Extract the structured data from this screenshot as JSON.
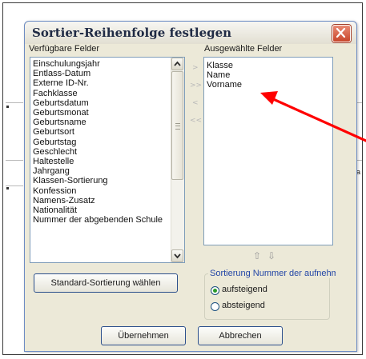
{
  "dialog": {
    "title": "Sortier-Reihenfolge festlegen",
    "available_label": "Verfügbare Felder",
    "selected_label": "Ausgewählte Felder",
    "available_items": [
      "Einschulungsjahr",
      "Entlass-Datum",
      "Externe ID-Nr.",
      "Fachklasse",
      "Geburtsdatum",
      "Geburtsmonat",
      "Geburtsname",
      "Geburtsort",
      "Geburtstag",
      "Geschlecht",
      "Haltestelle",
      "Jahrgang",
      "Klassen-Sortierung",
      "Konfession",
      "Namens-Zusatz",
      "Nationalität",
      "Nummer der abgebenden Schule"
    ],
    "selected_items": [
      "Klasse",
      "Name",
      "Vorname"
    ],
    "move_buttons": [
      ">",
      ">>",
      "<",
      "<<"
    ],
    "order_up": "⇧",
    "order_down": "⇩",
    "standard_button": "Standard-Sortierung wählen",
    "sort_group_label": "Sortierung Nummer der aufnehmenden",
    "ascending_label": "aufsteigend",
    "descending_label": "absteigend",
    "sort_selected": "aufsteigend",
    "apply_button": "Übernehmen",
    "cancel_button": "Abbrechen"
  },
  "background": {
    "partial_text": "a"
  },
  "colors": {
    "annotation_arrow": "#ff0000",
    "close_button": "#c8452a",
    "radio_selected": "#2a9a2a"
  },
  "icons": {
    "close": "close-icon",
    "scroll_up": "chevron-up-icon",
    "scroll_down": "chevron-down-icon"
  }
}
